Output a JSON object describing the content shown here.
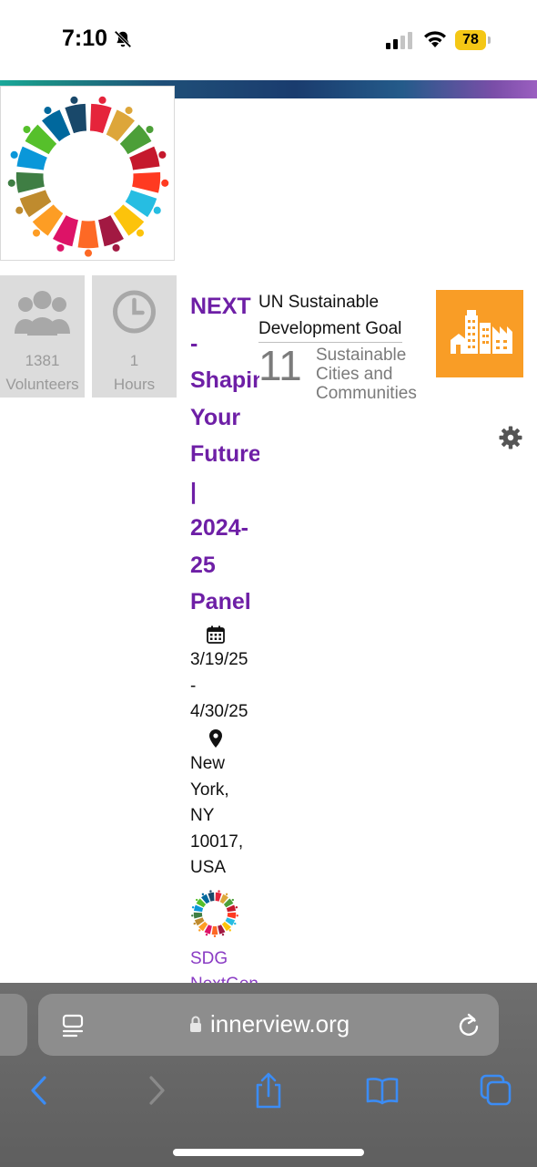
{
  "status_bar": {
    "time": "7:10",
    "battery": "78"
  },
  "stats": [
    {
      "value": "1381",
      "label": "Volunteers"
    },
    {
      "value": "1",
      "label": "Hours"
    }
  ],
  "event": {
    "title_lines": [
      "NEXT",
      "-",
      "Shapin",
      "Your",
      "Future",
      "|",
      "2024-",
      "25",
      "Panel"
    ],
    "date_lines": [
      "3/19/25",
      "-",
      "4/30/25"
    ],
    "location_lines": [
      "New",
      "York,",
      "NY",
      "10017,",
      "USA"
    ],
    "tag": "SDG NextGen"
  },
  "goal": {
    "heading": "UN Sustainable Development Goal",
    "number": "11",
    "name": "Sustainable Cities and Communities",
    "color": "#f99d26"
  },
  "browser": {
    "url": "innerview.org"
  },
  "colors": {
    "title_purple": "#6e1fa6",
    "link_purple": "#8a3cc4"
  }
}
